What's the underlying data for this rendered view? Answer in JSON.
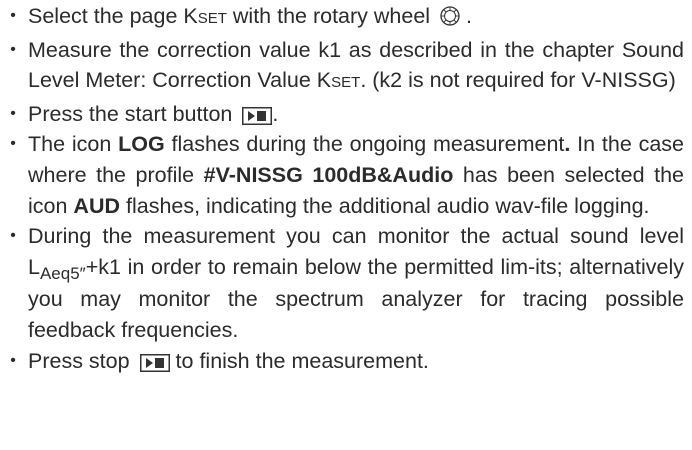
{
  "steps": [
    {
      "before": "Select the page K",
      "ksub": "SET",
      "after": " with the rotary wheel",
      "icon": "rotary-wheel-icon",
      "end": " ."
    },
    {
      "line": "Measure the correction value k1 as described in the chapter Sound Level Meter: Correction Value K",
      "ksub": "SET",
      "after": ". (k2 is not required for V-NISSG)"
    },
    {
      "before": "Press the start button",
      "icon": "play-stop-icon",
      "end": "."
    },
    {
      "t1": "The icon ",
      "b1": "LOG",
      "t2": " flashes during the ongoing measurement",
      "b2": ".",
      "t3": " In the case where the profile ",
      "b3": "#V-NISSG 100dB&Audio",
      "t4": " has been selected the icon ",
      "b4": "AUD",
      "t5": " flashes, indicating the additional audio wav-file logging."
    },
    {
      "t1": "During the measurement you can monitor the actual sound level L",
      "sub": "Aeq5″",
      "t2": "+k1 in order to remain below the permitted lim-its; alternatively you may monitor the spectrum analyzer for tracing possible feedback frequencies."
    },
    {
      "before": "Press stop",
      "icon": "play-stop-icon",
      "after": " to finish the measurement."
    }
  ],
  "bullet": "•"
}
